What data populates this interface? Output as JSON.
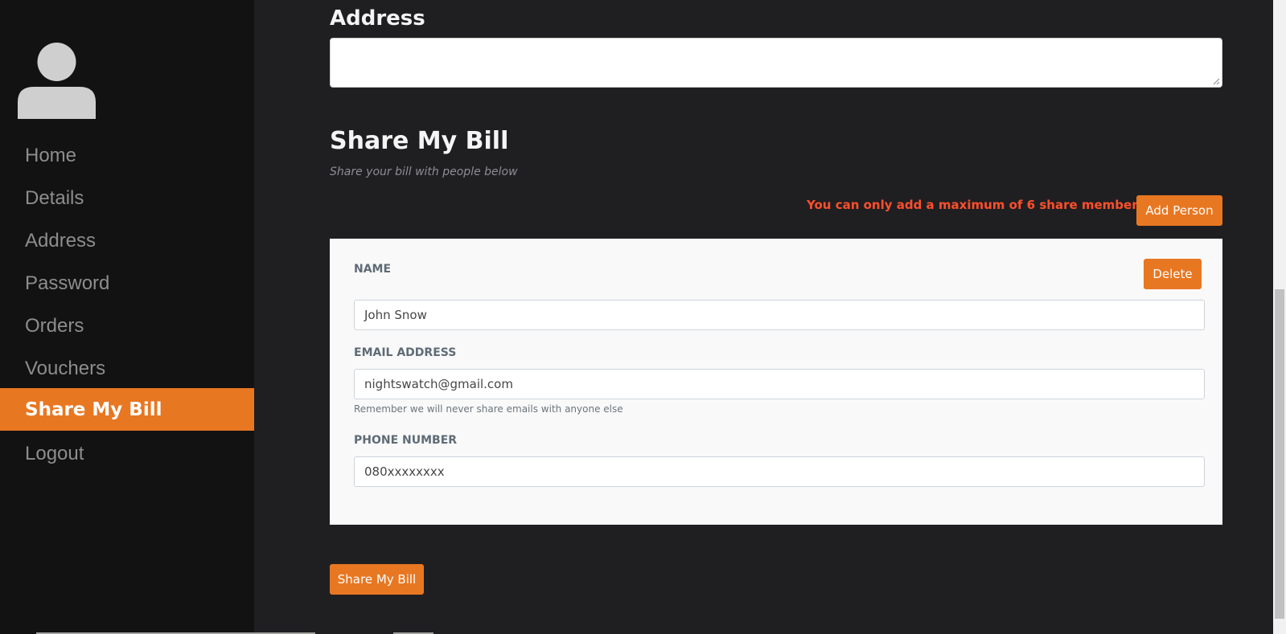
{
  "sidebar": {
    "avatar_icon": "user-avatar-icon",
    "items": [
      {
        "label": "Home",
        "active": false
      },
      {
        "label": "Details",
        "active": false
      },
      {
        "label": "Address",
        "active": false
      },
      {
        "label": "Password",
        "active": false
      },
      {
        "label": "Orders",
        "active": false
      },
      {
        "label": "Vouchers",
        "active": false
      },
      {
        "label": "Share My Bill",
        "active": true
      },
      {
        "label": "Logout",
        "active": false
      }
    ]
  },
  "address_section": {
    "title": "Address",
    "value": ""
  },
  "share_section": {
    "title": "Share My Bill",
    "subtitle": "Share your bill with people below",
    "limit_warning": "You can only add a maximum of 6 share members",
    "add_button": "Add Person",
    "submit_button": "Share My Bill",
    "members": [
      {
        "name_label": "NAME",
        "name_value": "John Snow",
        "delete_button": "Delete",
        "email_label": "EMAIL ADDRESS",
        "email_value": "nightswatch@gmail.com",
        "email_hint": "Remember we will never share emails with anyone else",
        "phone_label": "PHONE NUMBER",
        "phone_value": "080xxxxxxxx"
      }
    ]
  },
  "colors": {
    "accent": "#e87722",
    "sidebar_bg": "#121212",
    "main_bg": "#1f1f22",
    "warning": "#ff4f2b"
  }
}
